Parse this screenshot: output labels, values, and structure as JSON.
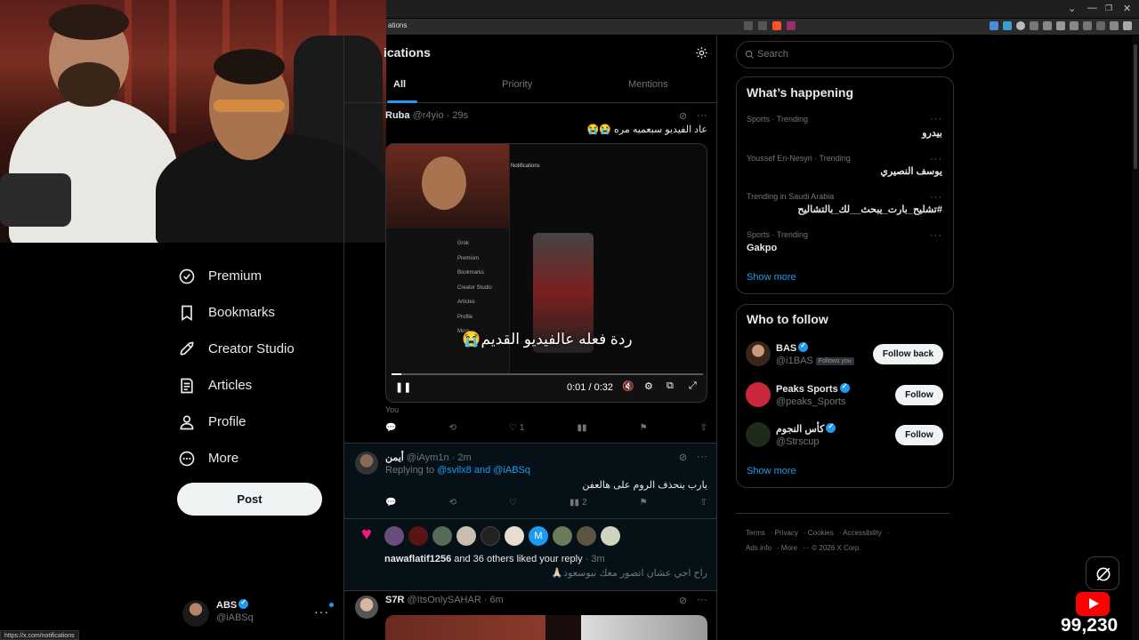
{
  "browser": {
    "url_fragment": "ations",
    "status_url": "https://x.com/notifications"
  },
  "nav": {
    "items": [
      {
        "label": "Premium",
        "icon": "premium-icon"
      },
      {
        "label": "Bookmarks",
        "icon": "bookmark-icon"
      },
      {
        "label": "Creator Studio",
        "icon": "rocket-icon"
      },
      {
        "label": "Articles",
        "icon": "article-icon"
      },
      {
        "label": "Profile",
        "icon": "person-icon"
      },
      {
        "label": "More",
        "icon": "more-circle-icon"
      }
    ],
    "post_label": "Post"
  },
  "account": {
    "name": "ABS",
    "handle": "@iABSq"
  },
  "notifications": {
    "title": "ications",
    "tabs": [
      "All",
      "Priority",
      "Mentions"
    ]
  },
  "tweet1": {
    "name": "Ruba",
    "handle": "@r4yio",
    "time": "· 29s",
    "text": "عاد الفيديو سبعميه مره 😭😭",
    "caption": "ردة فعله عالفيديو القديم😭",
    "video_time": "0:01 / 0:32",
    "video_progress": 0.03,
    "you_label": "You",
    "likes": "1"
  },
  "tweet2": {
    "name": "أيمن",
    "handle": "@iAym1n",
    "time": "· 2m",
    "replying_prefix": "Replying to",
    "replying_to": "@svilx8 and @iABSq",
    "text": "يارب ينحذف الروم على هالعفن",
    "views": "2"
  },
  "liked": {
    "user": "nawaflatif1256",
    "rest": "and 36 others liked your reply",
    "time": "· 3m",
    "text": "راح اجي عشان اتصور معك بيوسعود🙏🏻",
    "avatar_letter": "M"
  },
  "tweet3": {
    "name": "S7R",
    "handle": "@ItsOnlySAHAR",
    "time": "· 6m"
  },
  "search": {
    "placeholder": "Search"
  },
  "happening": {
    "title": "What’s happening",
    "trends": [
      {
        "meta": "Sports · Trending",
        "name": "بيدرو"
      },
      {
        "meta": "Youssef En-Nesyri · Trending",
        "name": "يوسف النصيري"
      },
      {
        "meta": "Trending in Saudi Arabia",
        "name": "#تشليح_بارت_يبحث__لك_بالتشاليح"
      },
      {
        "meta": "Sports · Trending",
        "name": "Gakpo"
      }
    ],
    "show_more": "Show more"
  },
  "who_to_follow": {
    "title": "Who to follow",
    "users": [
      {
        "name": "BAS",
        "handle": "@i1BAS",
        "follows_you": "Follows you",
        "button": "Follow back"
      },
      {
        "name": "Peaks Sports",
        "handle": "@peaks_Sports",
        "button": "Follow"
      },
      {
        "name": "كأس النجوم",
        "handle": "@Strscup",
        "button": "Follow"
      }
    ],
    "show_more": "Show more"
  },
  "footer": {
    "links": [
      "Terms",
      "Privacy",
      "Cookies",
      "Accessibility",
      "Ads info",
      "More"
    ],
    "copyright": "© 2026 X Corp."
  },
  "stream": {
    "viewers": "99,230"
  },
  "colors": {
    "accent": "#1d9bf0",
    "bg": "#000000",
    "border": "#2f3336",
    "like_pink": "#f91880"
  }
}
